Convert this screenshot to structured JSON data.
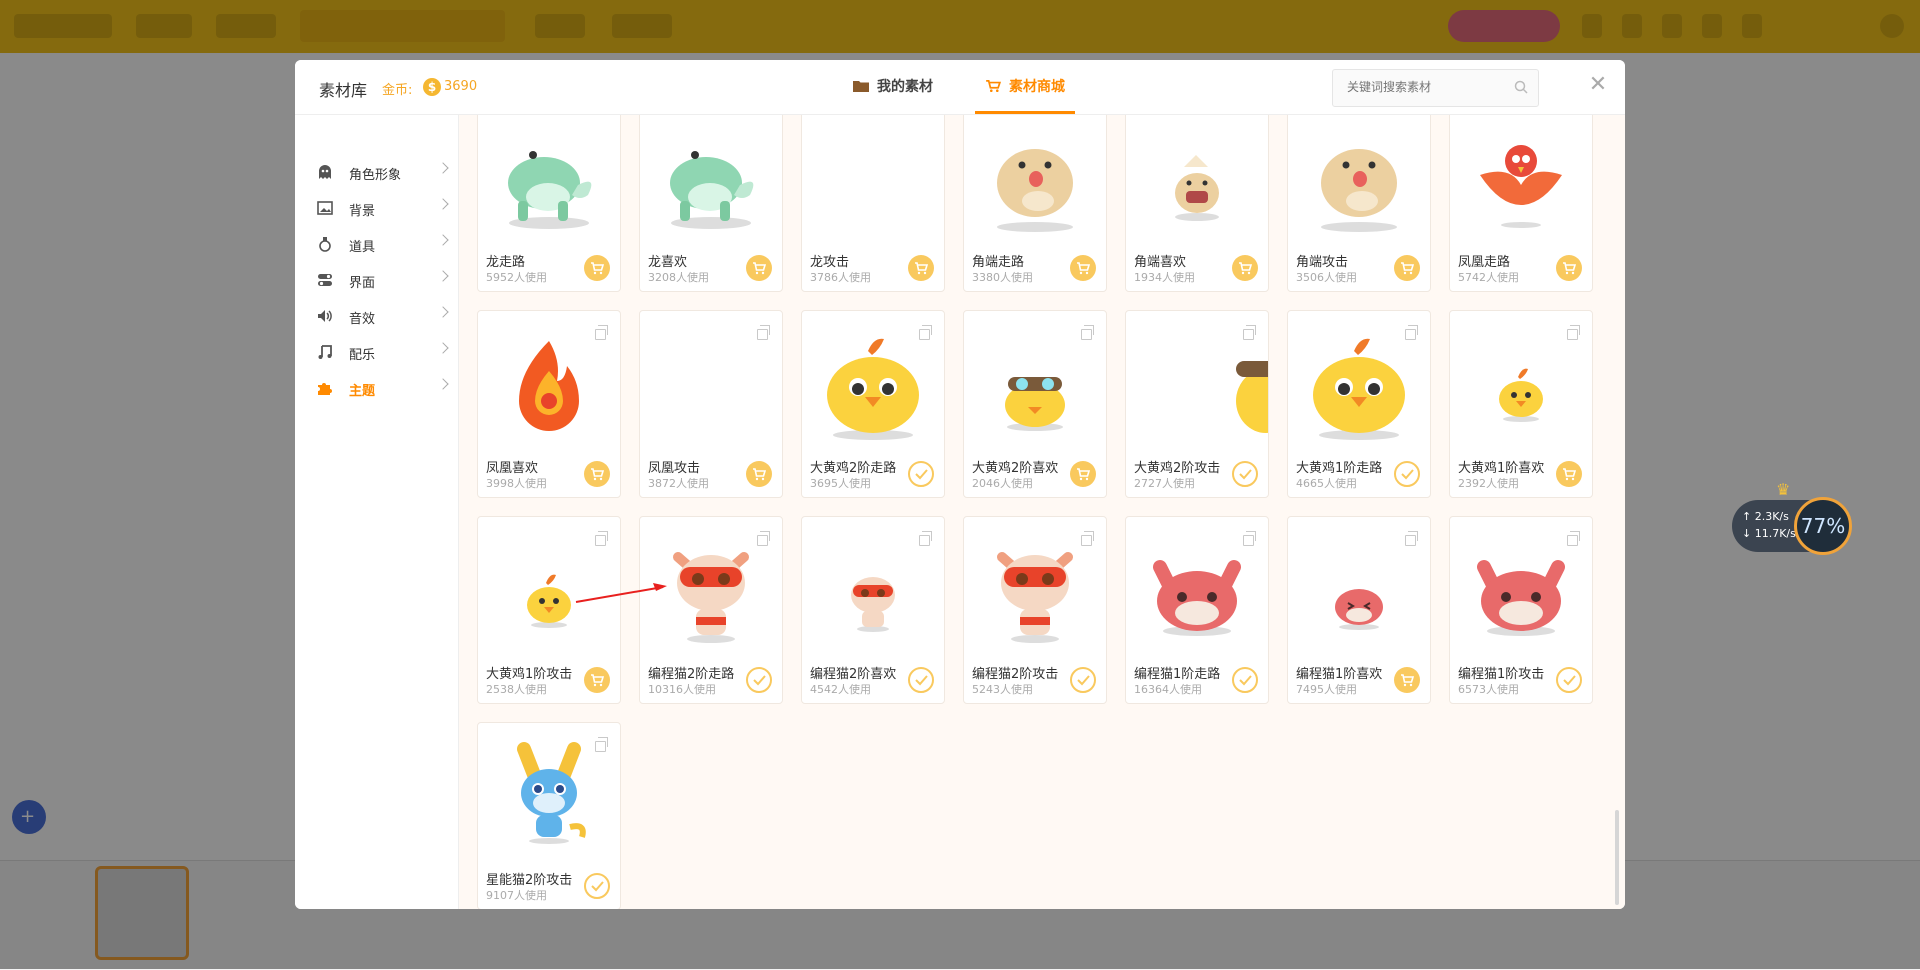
{
  "modal": {
    "title": "素材库",
    "coin_label": "金币:",
    "coin_symbol": "$",
    "coin_value": "3690",
    "tabs": [
      {
        "label": "我的素材",
        "active": false
      },
      {
        "label": "素材商城",
        "active": true
      }
    ],
    "search_placeholder": "关键词搜索素材"
  },
  "sidebar": {
    "items": [
      {
        "label": "角色形象",
        "icon": "ghost-icon",
        "active": false
      },
      {
        "label": "背景",
        "icon": "image-icon",
        "active": false
      },
      {
        "label": "道具",
        "icon": "potion-icon",
        "active": false
      },
      {
        "label": "界面",
        "icon": "toggle-icon",
        "active": false
      },
      {
        "label": "音效",
        "icon": "speaker-icon",
        "active": false
      },
      {
        "label": "配乐",
        "icon": "music-note-icon",
        "active": false
      },
      {
        "label": "主题",
        "icon": "puzzle-icon",
        "active": true
      }
    ]
  },
  "assets": [
    {
      "name": "龙走路",
      "uses": "5952人使用",
      "status": "buy",
      "art": "dragon"
    },
    {
      "name": "龙喜欢",
      "uses": "3208人使用",
      "status": "buy",
      "art": "dragon"
    },
    {
      "name": "龙攻击",
      "uses": "3786人使用",
      "status": "buy",
      "art": "empty"
    },
    {
      "name": "角端走路",
      "uses": "3380人使用",
      "status": "buy",
      "art": "beast"
    },
    {
      "name": "角端喜欢",
      "uses": "1934人使用",
      "status": "buy",
      "art": "beast-small"
    },
    {
      "name": "角端攻击",
      "uses": "3506人使用",
      "status": "buy",
      "art": "beast"
    },
    {
      "name": "凤凰走路",
      "uses": "5742人使用",
      "status": "buy",
      "art": "phoenix-bird"
    },
    {
      "name": "凤凰喜欢",
      "uses": "3998人使用",
      "status": "buy",
      "art": "phoenix-fire"
    },
    {
      "name": "凤凰攻击",
      "uses": "3872人使用",
      "status": "buy",
      "art": "empty"
    },
    {
      "name": "大黄鸡2阶走路",
      "uses": "3695人使用",
      "status": "owned",
      "art": "chick-big"
    },
    {
      "name": "大黄鸡2阶喜欢",
      "uses": "2046人使用",
      "status": "buy",
      "art": "chick-goggles"
    },
    {
      "name": "大黄鸡2阶攻击",
      "uses": "2727人使用",
      "status": "owned",
      "art": "chick-edge"
    },
    {
      "name": "大黄鸡1阶走路",
      "uses": "4665人使用",
      "status": "owned",
      "art": "chick-big"
    },
    {
      "name": "大黄鸡1阶喜欢",
      "uses": "2392人使用",
      "status": "buy",
      "art": "chick-small"
    },
    {
      "name": "大黄鸡1阶攻击",
      "uses": "2538人使用",
      "status": "buy",
      "art": "chick-small"
    },
    {
      "name": "编程猫2阶走路",
      "uses": "10316人使用",
      "status": "owned",
      "art": "cat-hero"
    },
    {
      "name": "编程猫2阶喜欢",
      "uses": "4542人使用",
      "status": "owned",
      "art": "cat-hero-small"
    },
    {
      "name": "编程猫2阶攻击",
      "uses": "5243人使用",
      "status": "owned",
      "art": "cat-hero"
    },
    {
      "name": "编程猫1阶走路",
      "uses": "16364人使用",
      "status": "owned",
      "art": "cat-blob"
    },
    {
      "name": "编程猫1阶喜欢",
      "uses": "7495人使用",
      "status": "buy",
      "art": "cat-blob-small"
    },
    {
      "name": "编程猫1阶攻击",
      "uses": "6573人使用",
      "status": "owned",
      "art": "cat-blob"
    },
    {
      "name": "星能猫2阶攻击",
      "uses": "9107人使用",
      "status": "owned",
      "art": "star-cat"
    }
  ],
  "network_widget": {
    "badge": "VIP",
    "upload": "2.3K/s",
    "download": "11.7K/s",
    "percent": "77%"
  },
  "colors": {
    "accent": "#ff8a00",
    "coin": "#f5a623",
    "button": "#f9c95e",
    "app_bar": "#f3c21b"
  }
}
